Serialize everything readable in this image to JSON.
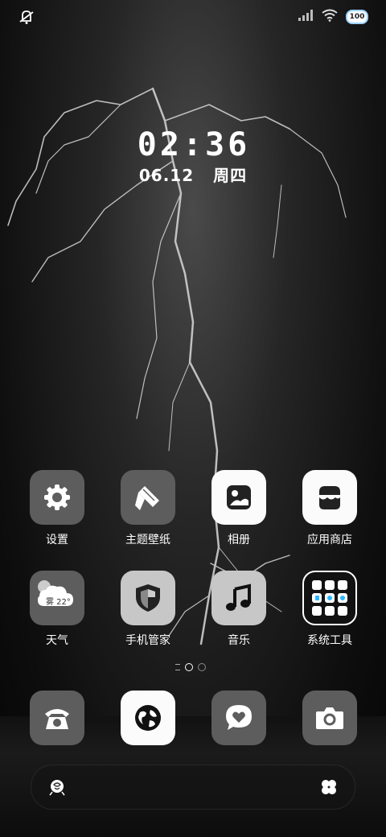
{
  "status_bar": {
    "battery_level": "100",
    "icons": [
      "silent-mode-icon",
      "signal-icon",
      "wifi-icon",
      "battery-icon"
    ]
  },
  "clock": {
    "time": "02:36",
    "date": "06.12",
    "weekday": "周四"
  },
  "apps": [
    {
      "label": "设置",
      "icon": "settings-gear-icon"
    },
    {
      "label": "主题壁纸",
      "icon": "theme-brush-icon"
    },
    {
      "label": "相册",
      "icon": "gallery-icon"
    },
    {
      "label": "应用商店",
      "icon": "app-store-icon"
    },
    {
      "label": "天气",
      "icon": "weather-icon",
      "weather_text": "雾 22°"
    },
    {
      "label": "手机管家",
      "icon": "phone-manager-shield-icon"
    },
    {
      "label": "音乐",
      "icon": "music-note-icon"
    },
    {
      "label": "系统工具",
      "icon": "system-tools-folder-icon"
    }
  ],
  "dock": [
    {
      "icon": "phone-icon"
    },
    {
      "icon": "browser-icon"
    },
    {
      "icon": "messages-icon"
    },
    {
      "icon": "camera-icon"
    }
  ],
  "page_indicator": {
    "current": 1,
    "total": 2
  },
  "search_bar": {
    "left_icon": "rose-icon",
    "right_icon": "clover-icon"
  }
}
